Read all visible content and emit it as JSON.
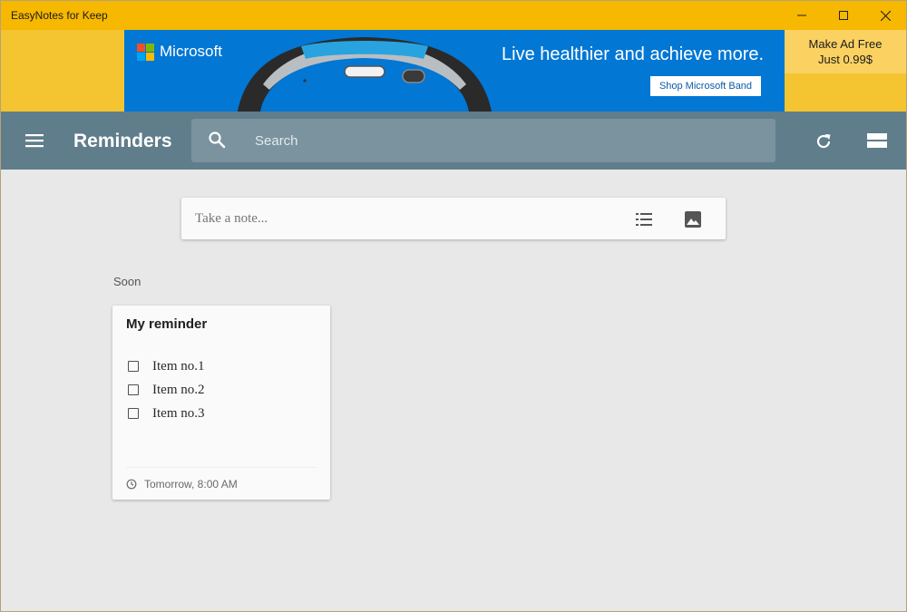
{
  "window": {
    "title": "EasyNotes for Keep"
  },
  "ad": {
    "brand": "Microsoft",
    "headline": "Live healthier and achieve more.",
    "cta": "Shop Microsoft Band",
    "adfree_line1": "Make Ad Free",
    "adfree_line2": "Just 0.99$"
  },
  "appbar": {
    "title": "Reminders",
    "search_placeholder": "Search"
  },
  "composer": {
    "placeholder": "Take a note..."
  },
  "section": {
    "label": "Soon"
  },
  "note": {
    "title": "My reminder",
    "items": [
      {
        "text": "Item no.1",
        "checked": false
      },
      {
        "text": "Item no.2",
        "checked": false
      },
      {
        "text": "Item no.3",
        "checked": false
      }
    ],
    "reminder": "Tomorrow, 8:00 AM"
  },
  "colors": {
    "titlebar": "#f6b800",
    "appbar": "#607d8b",
    "ad_blue": "#0277d4",
    "background": "#e8e8e8"
  },
  "icons": {
    "menu": "hamburger-icon",
    "search": "search-icon",
    "refresh": "refresh-icon",
    "layout": "view-layout-icon",
    "list": "checklist-icon",
    "image": "image-icon",
    "reminder": "clock-icon"
  }
}
